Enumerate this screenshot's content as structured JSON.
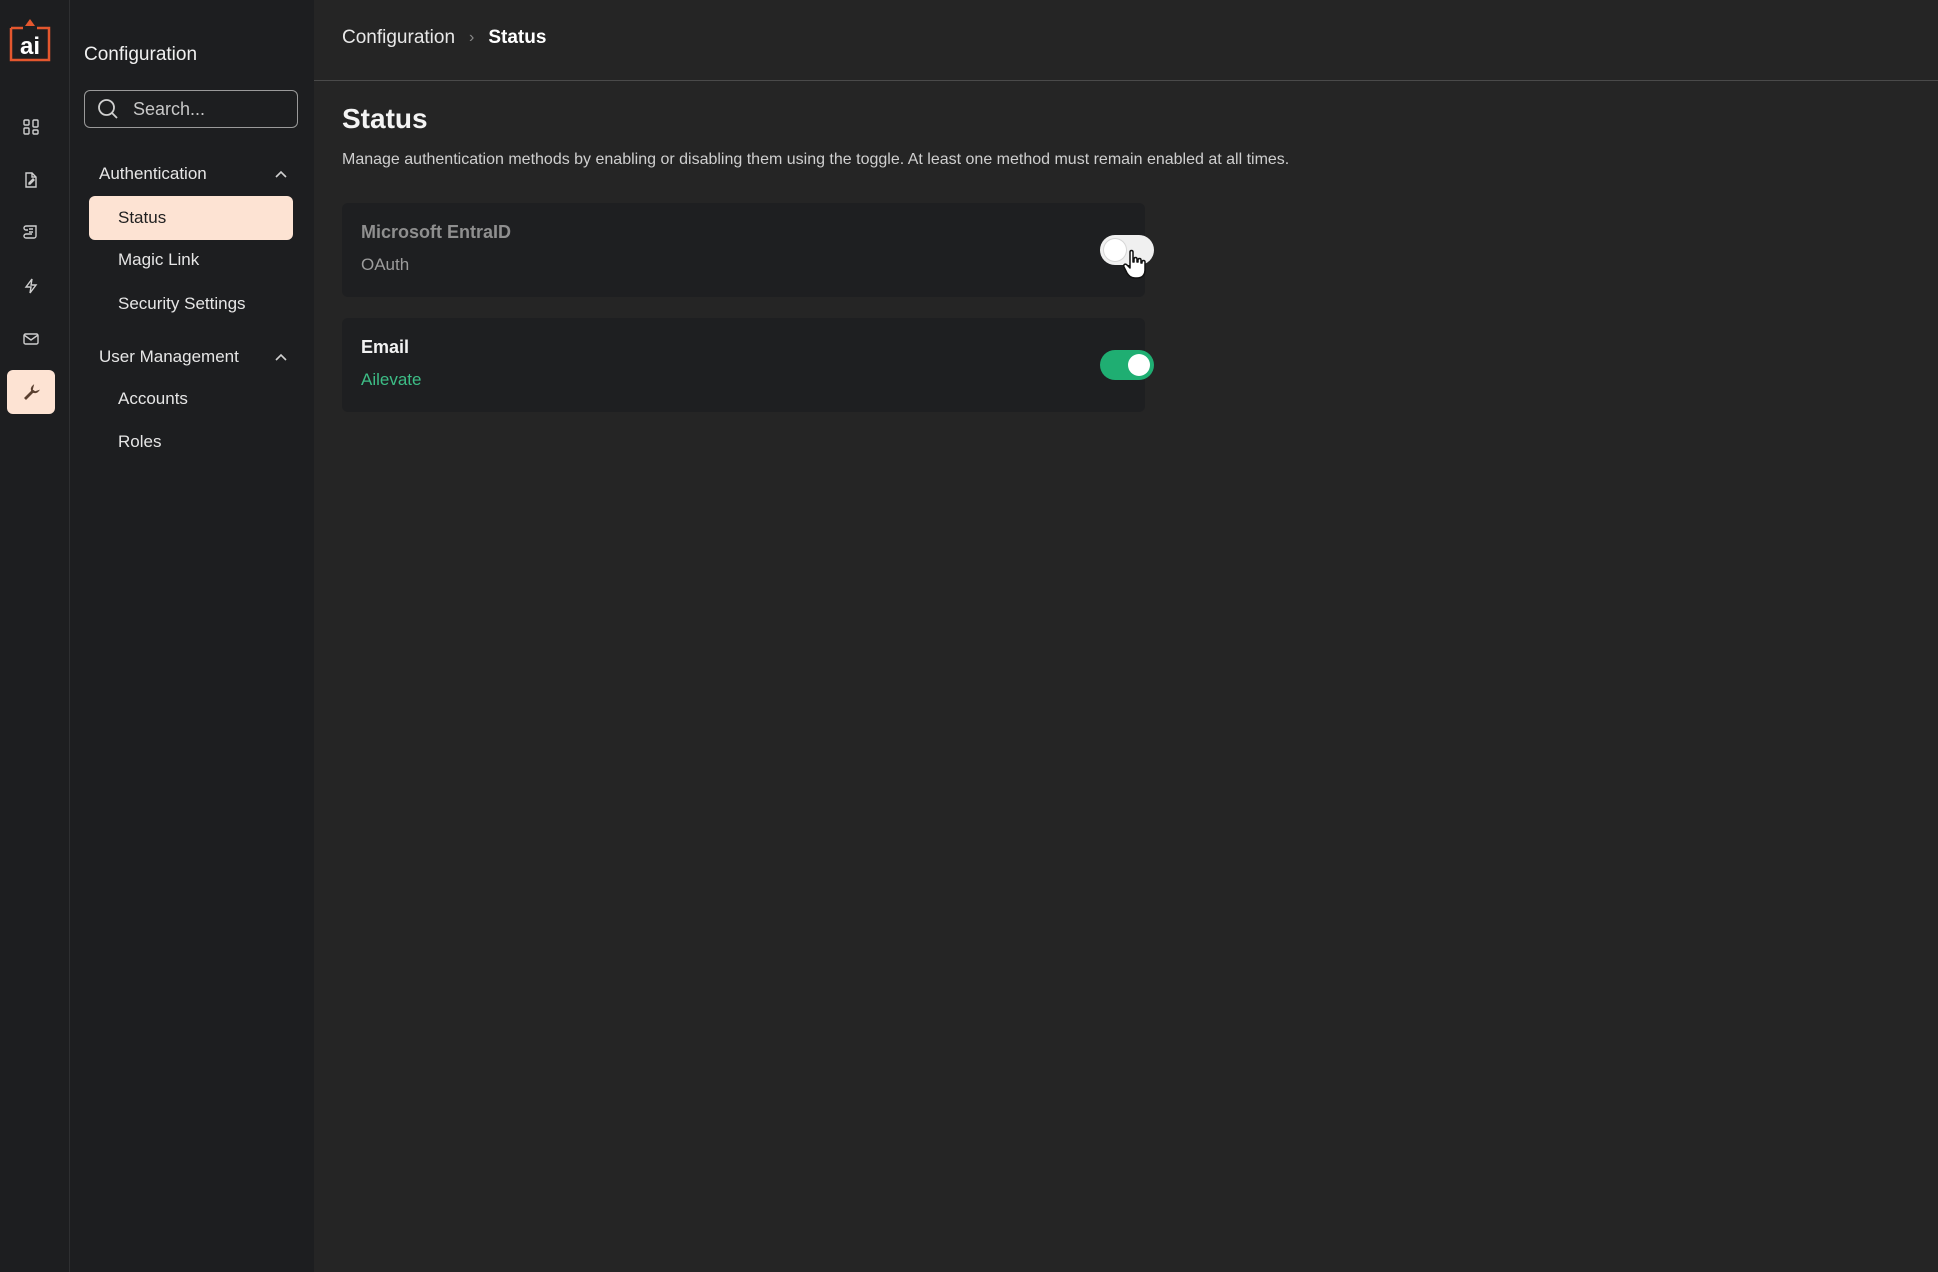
{
  "brand": {
    "logo_text": "ai",
    "accent": "#e4572e"
  },
  "rail": {
    "items": [
      {
        "icon": "dashboard-icon"
      },
      {
        "icon": "document-edit-icon"
      },
      {
        "icon": "scroll-icon"
      },
      {
        "icon": "lightning-icon"
      },
      {
        "icon": "mail-icon"
      },
      {
        "icon": "wrench-icon",
        "active": true
      }
    ]
  },
  "sidebar": {
    "title": "Configuration",
    "search_placeholder": "Search...",
    "groups": [
      {
        "label": "Authentication",
        "items": [
          {
            "label": "Status",
            "active": true
          },
          {
            "label": "Magic Link"
          },
          {
            "label": "Security Settings"
          }
        ]
      },
      {
        "label": "User Management",
        "items": [
          {
            "label": "Accounts"
          },
          {
            "label": "Roles"
          }
        ]
      }
    ]
  },
  "breadcrumb": {
    "parent": "Configuration",
    "separator": "›",
    "current": "Status"
  },
  "page": {
    "title": "Status",
    "description": "Manage authentication methods by enabling or disabling them using the toggle. At least one method must remain enabled at all times."
  },
  "methods": [
    {
      "name": "Microsoft EntraID",
      "provider": "OAuth",
      "enabled": false
    },
    {
      "name": "Email",
      "provider": "Ailevate",
      "enabled": true
    }
  ],
  "colors": {
    "toggle_on": "#1fae72",
    "active_nav": "#fde3d3",
    "provider_on": "#3dbd86"
  }
}
